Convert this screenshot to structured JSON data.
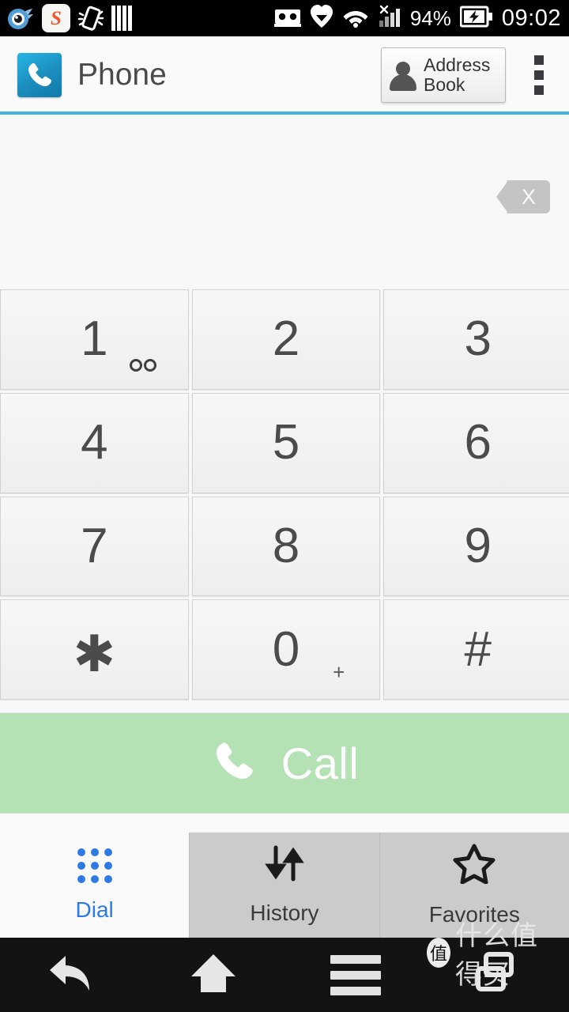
{
  "status_bar": {
    "time": "09:02",
    "battery_percent": "94%",
    "left_icons": [
      "comet-browser-icon",
      "sogou-input-icon",
      "shake-gesture-icon",
      "bars-icon"
    ],
    "right_icons": [
      "eyecare-glasses-icon",
      "heart-mail-icon",
      "wifi-icon",
      "signal-no-sim-icon",
      "battery-charging-icon"
    ],
    "background": "#000000"
  },
  "app_bar": {
    "title": "Phone",
    "app_icon": "phone-handset-icon",
    "address_book_label_line1": "Address",
    "address_book_label_line2": "Book",
    "address_book_icon": "person-icon",
    "overflow_icon": "overflow-menu-icon",
    "accent_color": "#3fb3dd"
  },
  "display": {
    "dialed_number": "",
    "placeholder": "",
    "backspace_icon": "backspace-delete-icon",
    "backspace_glyph": "X"
  },
  "keypad": {
    "rows": [
      [
        {
          "digit": "1",
          "sub": "",
          "sub_icon": "voicemail-icon",
          "name": "key-1"
        },
        {
          "digit": "2",
          "sub": "",
          "sub_icon": "",
          "name": "key-2"
        },
        {
          "digit": "3",
          "sub": "",
          "sub_icon": "",
          "name": "key-3"
        }
      ],
      [
        {
          "digit": "4",
          "sub": "",
          "sub_icon": "",
          "name": "key-4"
        },
        {
          "digit": "5",
          "sub": "",
          "sub_icon": "",
          "name": "key-5"
        },
        {
          "digit": "6",
          "sub": "",
          "sub_icon": "",
          "name": "key-6"
        }
      ],
      [
        {
          "digit": "7",
          "sub": "",
          "sub_icon": "",
          "name": "key-7"
        },
        {
          "digit": "8",
          "sub": "",
          "sub_icon": "",
          "name": "key-8"
        },
        {
          "digit": "9",
          "sub": "",
          "sub_icon": "",
          "name": "key-9"
        }
      ],
      [
        {
          "digit": "✱",
          "sub": "",
          "sub_icon": "",
          "name": "key-star"
        },
        {
          "digit": "0",
          "sub": "+",
          "sub_icon": "",
          "name": "key-0"
        },
        {
          "digit": "#",
          "sub": "",
          "sub_icon": "",
          "name": "key-hash"
        }
      ]
    ]
  },
  "call_button": {
    "label": "Call",
    "icon": "phone-handset-icon",
    "background": "#b5e2b4",
    "text_color": "#ffffff"
  },
  "tabs": [
    {
      "label": "Dial",
      "icon": "keypad-dots-icon",
      "active": true
    },
    {
      "label": "History",
      "icon": "call-history-arrows-icon",
      "active": false
    },
    {
      "label": "Favorites",
      "icon": "star-outline-icon",
      "active": false
    }
  ],
  "nav_bar": {
    "buttons": [
      {
        "name": "back-button",
        "icon": "back-arrow-icon"
      },
      {
        "name": "home-button",
        "icon": "home-icon"
      },
      {
        "name": "menu-button",
        "icon": "menu-hamburger-icon"
      },
      {
        "name": "recents-button",
        "icon": "recents-icon"
      }
    ],
    "watermark_badge": "值",
    "watermark_text": "什么值得买"
  }
}
